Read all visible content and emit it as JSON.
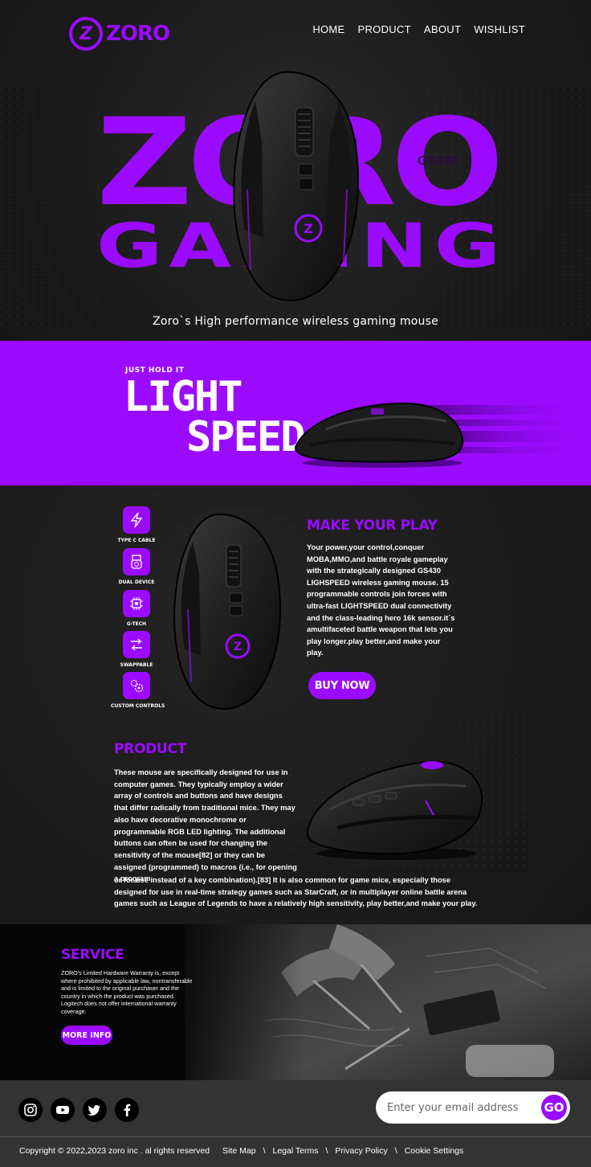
{
  "brand": {
    "logo_mark": "Z",
    "logo_text": "ZORO",
    "accent": "#9b0bff"
  },
  "nav": {
    "items": [
      {
        "label": "HOME"
      },
      {
        "label": "PRODUCT"
      },
      {
        "label": "ABOUT"
      },
      {
        "label": "WISHLIST"
      }
    ]
  },
  "hero": {
    "word1": "ZORO",
    "word2": "GAMING",
    "model": "GS430",
    "tagline": "Zoro`s High performance wireless gaming mouse"
  },
  "band": {
    "kicker": "JUST HOLD IT",
    "word1": "LIGHT",
    "word2": "SPEED"
  },
  "features": [
    {
      "label": "TYPE C CABLE",
      "icon": "lightning-icon"
    },
    {
      "label": "DUAL DEVICE",
      "icon": "usb-device-icon"
    },
    {
      "label": "G-TECH",
      "icon": "chip-icon"
    },
    {
      "label": "SWAPPABLE",
      "icon": "swap-arrows-icon"
    },
    {
      "label": "CUSTOM CONTROLS",
      "icon": "gears-icon"
    }
  ],
  "play": {
    "title": "MAKE YOUR PLAY",
    "text": "Your power,your control,conquer MOBA,MMO,and battle royale gameplay with the strategically designed GS430 LIGHSPEED wireless gaming mouse. 15 programmable controls join forces with ultra-fast  LIGHTSPEED dual connectivity and the class-leading hero 16k sensor.it´s amultifaceted battle weapon that lets you play longer.play better,and make your play.",
    "button": "BUY NOW"
  },
  "product": {
    "title": "PRODUCT",
    "text1": "These mouse are specifically designed for use in computer games. They typically employ a wider array of controls and buttons and have designs that differ radically from traditional mice. They may also have decorative monochrome or programmable RGB LED lighting. The additional buttons can often be used for changing the sensitivity of the mouse[82] or they can be assigned (programmed) to macros (i.e., for opening a program",
    "text2": "or for use instead of a key combination).[83] It is also common for game mice, especially those designed for use in real-time strategy games such as StarCraft, or in multiplayer online battle arena games such as League of Legends to have a relatively high sensitivity, play better,and make your play."
  },
  "service": {
    "title": "SERVICE",
    "text": "ZORO's Limited Hardware Warranty is, except where prohibited by applicable law, nontransferable and is limited to the original purchaser and the country in which the product was purchased. Logitech does not offer international warranty coverage.",
    "button": "MORE INFO"
  },
  "footer": {
    "socials": [
      "instagram-icon",
      "youtube-icon",
      "twitter-icon",
      "facebook-icon"
    ],
    "email_placeholder": "Enter your email address",
    "go": "GO",
    "copyright": "Copyright © 2022,2023 zoro inc . al rights reserved",
    "links": [
      "Site Map",
      "Legal Terms",
      "Privacy Policy",
      "Cookie Settings"
    ],
    "separator": "\\"
  }
}
